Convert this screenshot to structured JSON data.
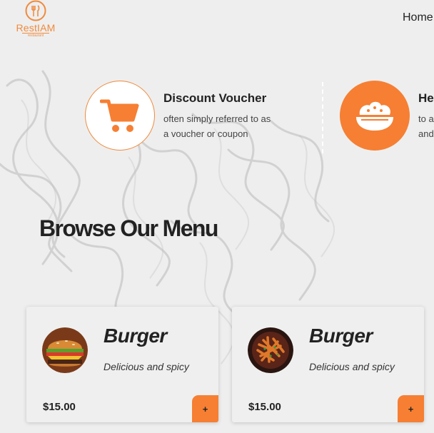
{
  "brand": {
    "name": "RestIAM",
    "tagline": "restaurant",
    "logo_icon": "cutlery-icon",
    "accent_color": "#f67f33"
  },
  "nav": {
    "home_label": "Home"
  },
  "features": [
    {
      "icon": "shopping-cart-icon",
      "title": "Discount Voucher",
      "line1": "often simply referred to as",
      "line2": "a voucher or coupon"
    },
    {
      "icon": "food-bowl-icon",
      "title": "Hea",
      "line1": "to a",
      "line2": "and"
    }
  ],
  "menu": {
    "title": "Browse Our Menu",
    "items": [
      {
        "image": "burger-image",
        "name": "Burger",
        "description": "Delicious and spicy",
        "price": "$15.00",
        "add_label": "+"
      },
      {
        "image": "fries-bowl-image",
        "name": "Burger",
        "description": "Delicious and spicy",
        "price": "$15.00",
        "add_label": "+"
      }
    ]
  }
}
